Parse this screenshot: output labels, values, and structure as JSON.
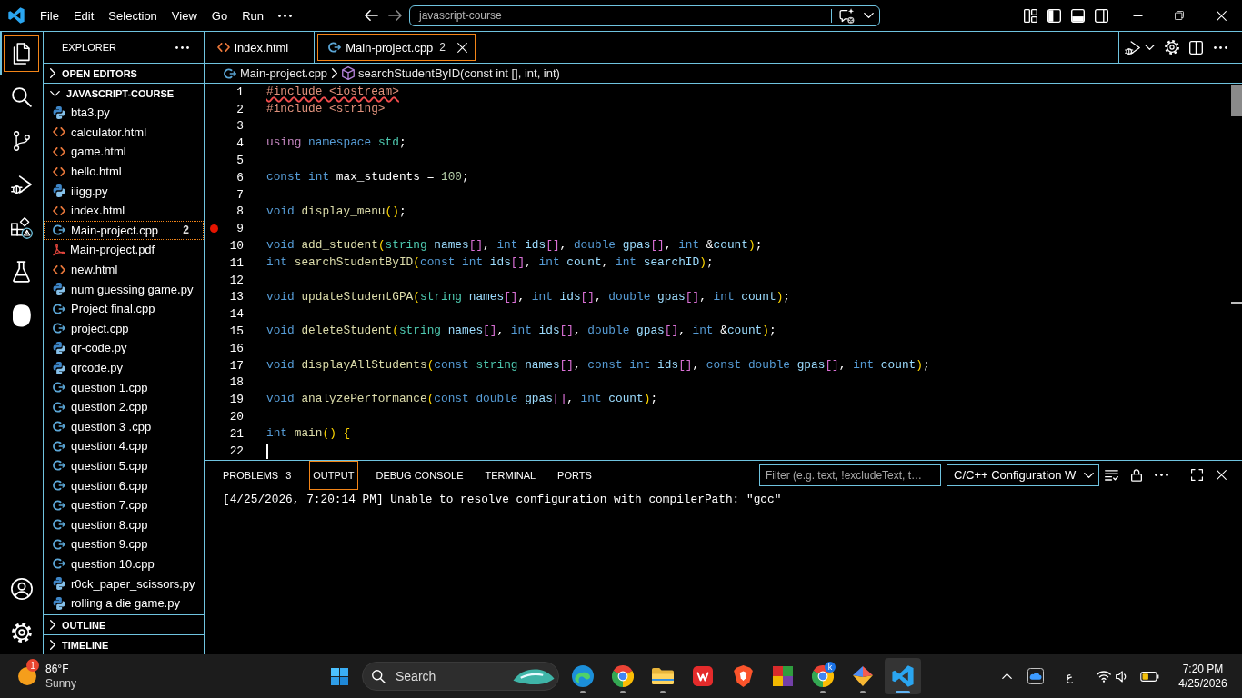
{
  "title_bar": {
    "menu": [
      "File",
      "Edit",
      "Selection",
      "View",
      "Go",
      "Run"
    ],
    "command_center": "javascript-course"
  },
  "activity_bar": {
    "top": [
      {
        "kind": "files",
        "selected": true
      },
      {
        "kind": "search",
        "selected": false
      },
      {
        "kind": "branch",
        "selected": false
      },
      {
        "kind": "play-bug",
        "selected": false
      },
      {
        "kind": "blocks-warning",
        "selected": false
      },
      {
        "kind": "flask",
        "selected": false
      },
      {
        "kind": "blob",
        "selected": false
      }
    ],
    "bottom": [
      {
        "kind": "person",
        "selected": false
      },
      {
        "kind": "settings",
        "selected": false
      }
    ]
  },
  "sidebar": {
    "title": "EXPLORER",
    "sections": [
      {
        "label": "OPEN EDITORS",
        "expanded": false
      },
      {
        "label": "JAVASCRIPT-COURSE",
        "expanded": true,
        "files": [
          {
            "name": "bta3.py",
            "kind": "python",
            "selected": false
          },
          {
            "name": "calculator.html",
            "kind": "html",
            "selected": false
          },
          {
            "name": "game.html",
            "kind": "html",
            "selected": false
          },
          {
            "name": "hello.html",
            "kind": "html",
            "selected": false
          },
          {
            "name": "iiigg.py",
            "kind": "python",
            "selected": false
          },
          {
            "name": "index.html",
            "kind": "html",
            "selected": false
          },
          {
            "name": "Main-project.cpp",
            "kind": "cpp",
            "selected": true,
            "badge": "2"
          },
          {
            "name": "Main-project.pdf",
            "kind": "pdf",
            "selected": false
          },
          {
            "name": "new.html",
            "kind": "html",
            "selected": false
          },
          {
            "name": "num guessing game.py",
            "kind": "python",
            "selected": false
          },
          {
            "name": "Project final.cpp",
            "kind": "cpp",
            "selected": false
          },
          {
            "name": "project.cpp",
            "kind": "cpp",
            "selected": false
          },
          {
            "name": "qr-code.py",
            "kind": "python",
            "selected": false
          },
          {
            "name": "qrcode.py",
            "kind": "python",
            "selected": false
          },
          {
            "name": "question 1.cpp",
            "kind": "cpp",
            "selected": false
          },
          {
            "name": "question 2.cpp",
            "kind": "cpp",
            "selected": false
          },
          {
            "name": "question 3 .cpp",
            "kind": "cpp",
            "selected": false
          },
          {
            "name": "question 4.cpp",
            "kind": "cpp",
            "selected": false
          },
          {
            "name": "question 5.cpp",
            "kind": "cpp",
            "selected": false
          },
          {
            "name": "question 6.cpp",
            "kind": "cpp",
            "selected": false
          },
          {
            "name": "question 7.cpp",
            "kind": "cpp",
            "selected": false
          },
          {
            "name": "question 8.cpp",
            "kind": "cpp",
            "selected": false
          },
          {
            "name": "question 9.cpp",
            "kind": "cpp",
            "selected": false
          },
          {
            "name": "question 10.cpp",
            "kind": "cpp",
            "selected": false
          },
          {
            "name": "r0ck_paper_scissors.py",
            "kind": "python",
            "selected": false
          },
          {
            "name": "rolling a die game.py",
            "kind": "python",
            "selected": false
          }
        ]
      },
      {
        "label": "OUTLINE",
        "expanded": false
      },
      {
        "label": "TIMELINE",
        "expanded": false
      }
    ]
  },
  "editor": {
    "tabs": [
      {
        "label": "index.html",
        "kind": "html",
        "selected": false
      },
      {
        "label": "Main-project.cpp",
        "kind": "cpp",
        "selected": true,
        "badge": "2"
      }
    ],
    "breadcrumbs": [
      {
        "label": "Main-project.cpp",
        "kind": "cpp"
      },
      {
        "label": "searchStudentByID(const int [], int, int)",
        "kind": "method"
      }
    ],
    "lines": [
      {
        "number": "1",
        "breakpoint": false,
        "error": true,
        "caret": false,
        "tokens": [
          {
            "kind": "preproc",
            "text": "#include <iostream>"
          }
        ]
      },
      {
        "number": "2",
        "breakpoint": false,
        "error": false,
        "caret": false,
        "tokens": [
          {
            "kind": "preproc",
            "text": "#include <string>"
          }
        ]
      },
      {
        "number": "3",
        "breakpoint": false,
        "caret": false
      },
      {
        "number": "4",
        "breakpoint": false,
        "error": false,
        "caret": false,
        "tokens": [
          {
            "kind": "keyword",
            "text": "using"
          },
          {
            "kind": "storage",
            "text": " namespace"
          },
          {
            "kind": "type",
            "text": " std"
          },
          {
            "kind": "plain",
            "text": ";"
          }
        ]
      },
      {
        "number": "5",
        "breakpoint": false,
        "caret": false
      },
      {
        "number": "6",
        "breakpoint": false,
        "error": false,
        "caret": false,
        "tokens": [
          {
            "kind": "storage",
            "text": "const int"
          },
          {
            "kind": "plain",
            "text": " max_students = "
          },
          {
            "kind": "number",
            "text": "100"
          },
          {
            "kind": "plain",
            "text": ";"
          }
        ]
      },
      {
        "number": "7",
        "breakpoint": false,
        "caret": false
      },
      {
        "number": "8",
        "breakpoint": false,
        "error": false,
        "caret": false,
        "tokens": [
          {
            "kind": "storage",
            "text": "void"
          },
          {
            "kind": "function",
            "text": " display_menu"
          },
          {
            "kind": "paren",
            "text": "()"
          },
          {
            "kind": "plain",
            "text": ";"
          }
        ]
      },
      {
        "number": "9",
        "breakpoint": true,
        "caret": false
      },
      {
        "number": "10",
        "breakpoint": false,
        "error": false,
        "caret": false,
        "tokens": [
          {
            "kind": "storage",
            "text": "void"
          },
          {
            "kind": "function",
            "text": " add_student"
          },
          {
            "kind": "paren",
            "text": "("
          },
          {
            "kind": "type",
            "text": "string"
          },
          {
            "kind": "variable",
            "text": " names"
          },
          {
            "kind": "bracket",
            "text": "[]"
          },
          {
            "kind": "plain",
            "text": ", "
          },
          {
            "kind": "storage",
            "text": "int"
          },
          {
            "kind": "variable",
            "text": " ids"
          },
          {
            "kind": "bracket",
            "text": "[]"
          },
          {
            "kind": "plain",
            "text": ", "
          },
          {
            "kind": "storage",
            "text": "double"
          },
          {
            "kind": "variable",
            "text": " gpas"
          },
          {
            "kind": "bracket",
            "text": "[]"
          },
          {
            "kind": "plain",
            "text": ", "
          },
          {
            "kind": "storage",
            "text": "int"
          },
          {
            "kind": "plain",
            "text": " &"
          },
          {
            "kind": "variable",
            "text": "count"
          },
          {
            "kind": "paren",
            "text": ")"
          },
          {
            "kind": "plain",
            "text": ";"
          }
        ]
      },
      {
        "number": "11",
        "breakpoint": false,
        "error": false,
        "caret": false,
        "tokens": [
          {
            "kind": "storage",
            "text": "int"
          },
          {
            "kind": "function",
            "text": " searchStudentByID"
          },
          {
            "kind": "paren",
            "text": "("
          },
          {
            "kind": "storage",
            "text": "const int"
          },
          {
            "kind": "variable",
            "text": " ids"
          },
          {
            "kind": "bracket",
            "text": "[]"
          },
          {
            "kind": "plain",
            "text": ", "
          },
          {
            "kind": "storage",
            "text": "int"
          },
          {
            "kind": "variable",
            "text": " count"
          },
          {
            "kind": "plain",
            "text": ", "
          },
          {
            "kind": "storage",
            "text": "int"
          },
          {
            "kind": "variable",
            "text": " searchID"
          },
          {
            "kind": "paren",
            "text": ")"
          },
          {
            "kind": "plain",
            "text": ";"
          }
        ]
      },
      {
        "number": "12",
        "breakpoint": false,
        "caret": false
      },
      {
        "number": "13",
        "breakpoint": false,
        "error": false,
        "caret": false,
        "tokens": [
          {
            "kind": "storage",
            "text": "void"
          },
          {
            "kind": "function",
            "text": " updateStudentGPA"
          },
          {
            "kind": "paren",
            "text": "("
          },
          {
            "kind": "type",
            "text": "string"
          },
          {
            "kind": "variable",
            "text": " names"
          },
          {
            "kind": "bracket",
            "text": "[]"
          },
          {
            "kind": "plain",
            "text": ", "
          },
          {
            "kind": "storage",
            "text": "int"
          },
          {
            "kind": "variable",
            "text": " ids"
          },
          {
            "kind": "bracket",
            "text": "[]"
          },
          {
            "kind": "plain",
            "text": ", "
          },
          {
            "kind": "storage",
            "text": "double"
          },
          {
            "kind": "variable",
            "text": " gpas"
          },
          {
            "kind": "bracket",
            "text": "[]"
          },
          {
            "kind": "plain",
            "text": ", "
          },
          {
            "kind": "storage",
            "text": "int"
          },
          {
            "kind": "variable",
            "text": " count"
          },
          {
            "kind": "paren",
            "text": ")"
          },
          {
            "kind": "plain",
            "text": ";"
          }
        ]
      },
      {
        "number": "14",
        "breakpoint": false,
        "caret": false
      },
      {
        "number": "15",
        "breakpoint": false,
        "error": false,
        "caret": false,
        "tokens": [
          {
            "kind": "storage",
            "text": "void"
          },
          {
            "kind": "function",
            "text": " deleteStudent"
          },
          {
            "kind": "paren",
            "text": "("
          },
          {
            "kind": "type",
            "text": "string"
          },
          {
            "kind": "variable",
            "text": " names"
          },
          {
            "kind": "bracket",
            "text": "[]"
          },
          {
            "kind": "plain",
            "text": ", "
          },
          {
            "kind": "storage",
            "text": "int"
          },
          {
            "kind": "variable",
            "text": " ids"
          },
          {
            "kind": "bracket",
            "text": "[]"
          },
          {
            "kind": "plain",
            "text": ", "
          },
          {
            "kind": "storage",
            "text": "double"
          },
          {
            "kind": "variable",
            "text": " gpas"
          },
          {
            "kind": "bracket",
            "text": "[]"
          },
          {
            "kind": "plain",
            "text": ", "
          },
          {
            "kind": "storage",
            "text": "int"
          },
          {
            "kind": "plain",
            "text": " &"
          },
          {
            "kind": "variable",
            "text": "count"
          },
          {
            "kind": "paren",
            "text": ")"
          },
          {
            "kind": "plain",
            "text": ";"
          }
        ]
      },
      {
        "number": "16",
        "breakpoint": false,
        "caret": false
      },
      {
        "number": "17",
        "breakpoint": false,
        "error": false,
        "caret": false,
        "tokens": [
          {
            "kind": "storage",
            "text": "void"
          },
          {
            "kind": "function",
            "text": " displayAllStudents"
          },
          {
            "kind": "paren",
            "text": "("
          },
          {
            "kind": "storage",
            "text": "const"
          },
          {
            "kind": "type",
            "text": " string"
          },
          {
            "kind": "variable",
            "text": " names"
          },
          {
            "kind": "bracket",
            "text": "[]"
          },
          {
            "kind": "plain",
            "text": ", "
          },
          {
            "kind": "storage",
            "text": "const int"
          },
          {
            "kind": "variable",
            "text": " ids"
          },
          {
            "kind": "bracket",
            "text": "[]"
          },
          {
            "kind": "plain",
            "text": ", "
          },
          {
            "kind": "storage",
            "text": "const double"
          },
          {
            "kind": "variable",
            "text": " gpas"
          },
          {
            "kind": "bracket",
            "text": "[]"
          },
          {
            "kind": "plain",
            "text": ", "
          },
          {
            "kind": "storage",
            "text": "int"
          },
          {
            "kind": "variable",
            "text": " count"
          },
          {
            "kind": "paren",
            "text": ")"
          },
          {
            "kind": "plain",
            "text": ";"
          }
        ]
      },
      {
        "number": "18",
        "breakpoint": false,
        "caret": false
      },
      {
        "number": "19",
        "breakpoint": false,
        "error": false,
        "caret": false,
        "tokens": [
          {
            "kind": "storage",
            "text": "void"
          },
          {
            "kind": "function",
            "text": " analyzePerformance"
          },
          {
            "kind": "paren",
            "text": "("
          },
          {
            "kind": "storage",
            "text": "const double"
          },
          {
            "kind": "variable",
            "text": " gpas"
          },
          {
            "kind": "bracket",
            "text": "[]"
          },
          {
            "kind": "plain",
            "text": ", "
          },
          {
            "kind": "storage",
            "text": "int"
          },
          {
            "kind": "variable",
            "text": " count"
          },
          {
            "kind": "paren",
            "text": ")"
          },
          {
            "kind": "plain",
            "text": ";"
          }
        ]
      },
      {
        "number": "20",
        "breakpoint": false,
        "caret": false
      },
      {
        "number": "21",
        "breakpoint": false,
        "error": false,
        "caret": false,
        "tokens": [
          {
            "kind": "storage",
            "text": "int"
          },
          {
            "kind": "function",
            "text": " main"
          },
          {
            "kind": "paren",
            "text": "()"
          },
          {
            "kind": "paren",
            "text": " {"
          }
        ]
      },
      {
        "number": "22",
        "breakpoint": false,
        "caret": true
      }
    ]
  },
  "panel": {
    "tabs": [
      {
        "label": "PROBLEMS",
        "selected": false,
        "badge": "3"
      },
      {
        "label": "OUTPUT",
        "selected": true
      },
      {
        "label": "DEBUG CONSOLE",
        "selected": false
      },
      {
        "label": "TERMINAL",
        "selected": false
      },
      {
        "label": "PORTS",
        "selected": false
      }
    ],
    "filter": {
      "placeholder": "Filter (e.g. text, !excludeText, t…"
    },
    "channel": "C/C++ Configuration W",
    "output": [
      "[4/25/2026, 7:20:14 PM] Unable to resolve configuration with compilerPath: \"gcc\""
    ]
  },
  "taskbar": {
    "weather": {
      "badge": "1",
      "temperature": "86°F",
      "condition": "Sunny"
    },
    "search": {
      "placeholder": "Search"
    },
    "apps": [
      {
        "kind": "swirl",
        "running": true,
        "active": false
      },
      {
        "kind": "ring",
        "running": true,
        "active": false
      },
      {
        "kind": "folder",
        "running": true,
        "active": false
      },
      {
        "kind": "tile",
        "running": false,
        "active": false
      },
      {
        "kind": "shield",
        "running": false,
        "active": false
      },
      {
        "kind": "quad",
        "running": false,
        "active": false
      },
      {
        "kind": "ring",
        "badge": "k",
        "running": true,
        "active": false
      },
      {
        "kind": "kite",
        "running": true,
        "active": false
      },
      {
        "kind": "ribbon",
        "running": true,
        "active": true
      }
    ],
    "tray": {
      "language": "ع",
      "time": "7:20 PM",
      "date": "4/25/2026"
    }
  }
}
